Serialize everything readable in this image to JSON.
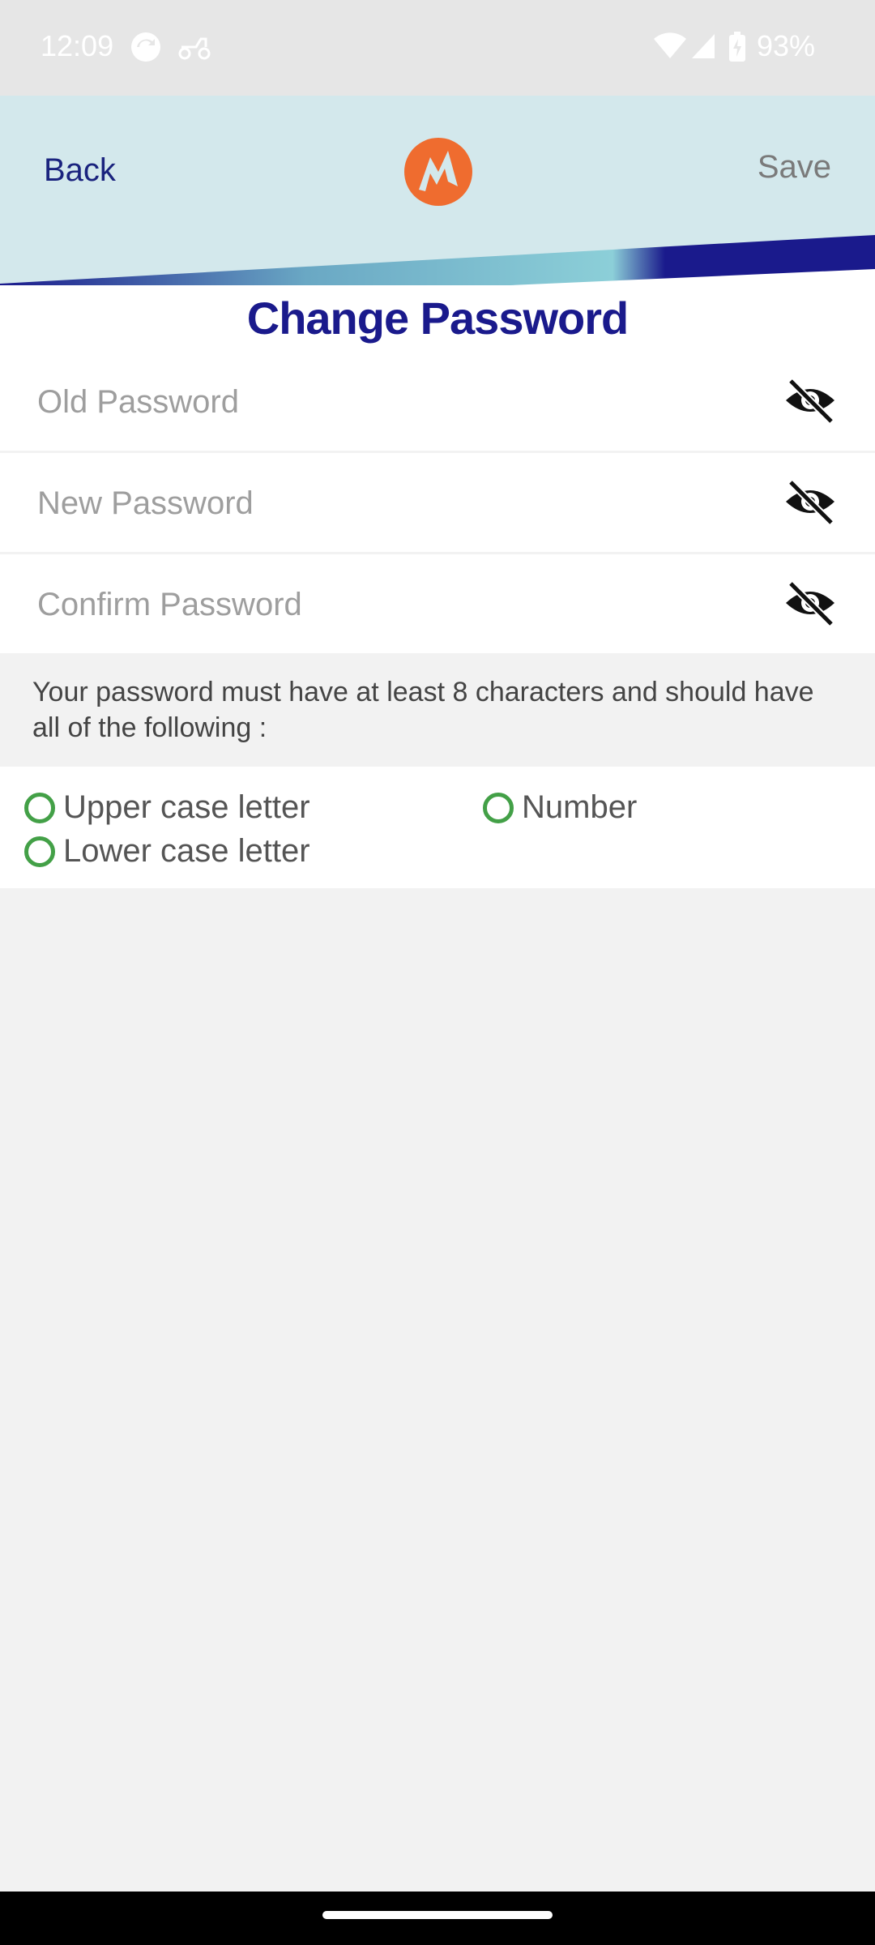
{
  "status_bar": {
    "time": "12:09",
    "battery": "93%"
  },
  "header": {
    "back_label": "Back",
    "save_label": "Save",
    "title": "Change Password"
  },
  "fields": {
    "old_password": {
      "placeholder": "Old Password",
      "value": ""
    },
    "new_password": {
      "placeholder": "New Password",
      "value": ""
    },
    "confirm_password": {
      "placeholder": "Confirm Password",
      "value": ""
    }
  },
  "info": {
    "text": "Your password must have at least 8 characters and should have all of the following :"
  },
  "requirements": [
    {
      "label": "Upper case letter",
      "met": false
    },
    {
      "label": "Number",
      "met": false
    },
    {
      "label": "Lower case letter",
      "met": false
    }
  ],
  "colors": {
    "accent": "#1a1a8c",
    "header_bg": "#d3e8ec",
    "logo": "#ef6c2f",
    "check_ring": "#43a047"
  },
  "icons": {
    "visibility_toggle": "eye-off-icon",
    "logo": "brand-logo-icon"
  }
}
